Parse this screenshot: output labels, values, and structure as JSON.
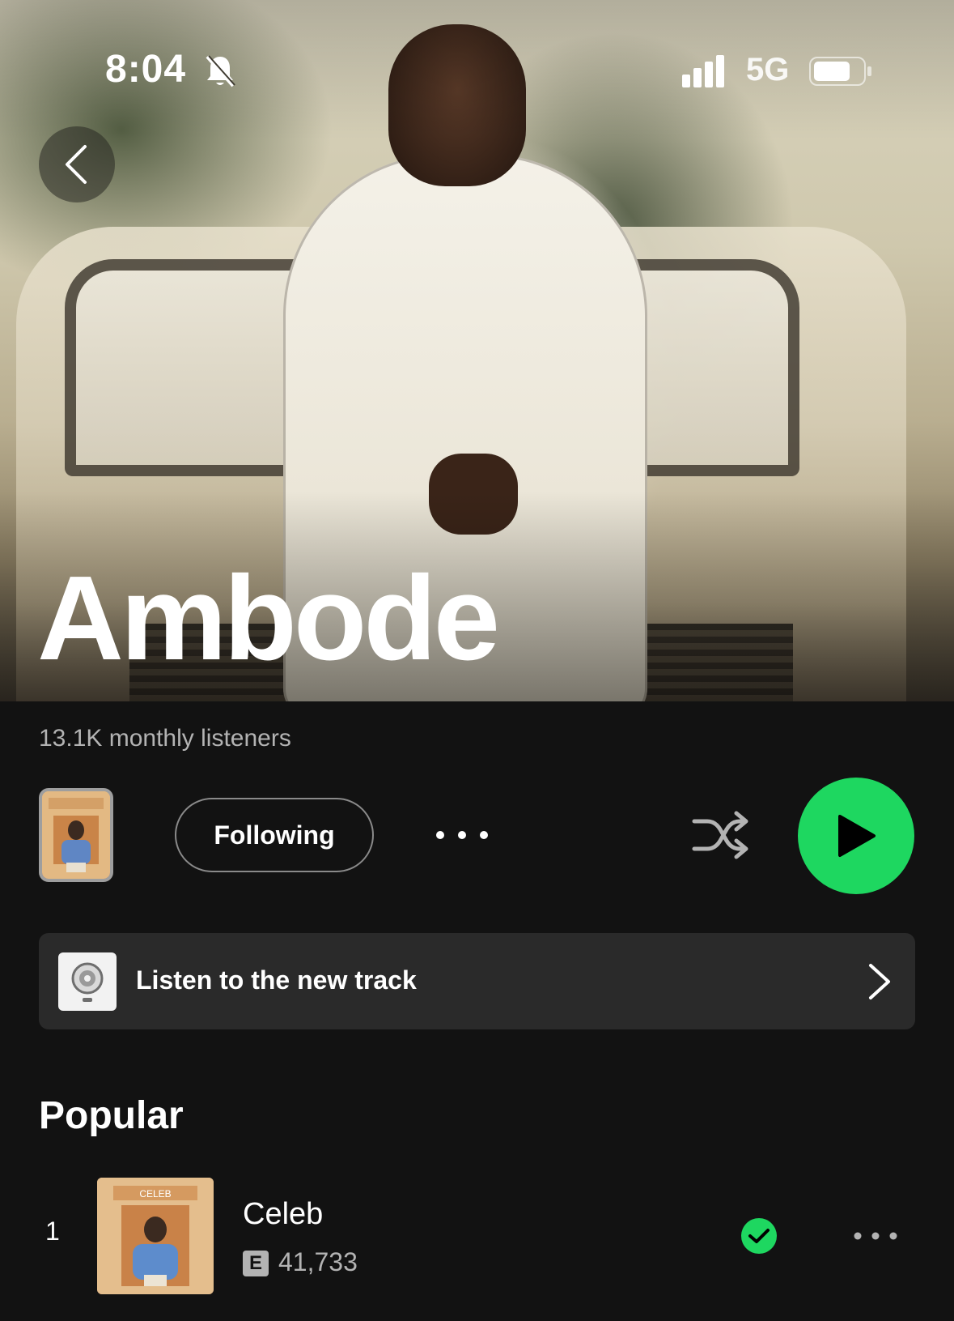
{
  "status_bar": {
    "time": "8:04",
    "network": "5G",
    "icons": [
      "bell-slash-icon",
      "signal-icon",
      "battery-icon"
    ]
  },
  "artist": {
    "name": "Ambode",
    "monthly_listeners": "13.1K monthly listeners"
  },
  "actions": {
    "follow_label": "Following",
    "icons": [
      "back-icon",
      "more-icon",
      "shuffle-icon",
      "play-icon"
    ]
  },
  "new_track_banner": {
    "label": "Listen to the new track",
    "icon": "chevron-right-icon"
  },
  "popular": {
    "title": "Popular",
    "tracks": [
      {
        "rank": "1",
        "title": "Celeb",
        "explicit_badge": "E",
        "plays": "41,733",
        "downloaded": true,
        "cover_text": "CELEB"
      }
    ]
  },
  "colors": {
    "background": "#121212",
    "accent_green": "#1ed760",
    "secondary_text": "#b3b3b3",
    "banner_bg": "#2a2a2a"
  }
}
